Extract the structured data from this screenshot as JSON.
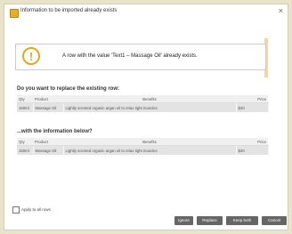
{
  "dialog": {
    "title": "Information to be imported already exists",
    "close_glyph": "×",
    "message": "A row with the value 'Text1 – Massage Oil' already exists."
  },
  "existing": {
    "heading": "Do you want to replace the existing row:",
    "columns": [
      "Qty",
      "Product",
      "Benefits",
      "Price"
    ],
    "row": [
      "150ml",
      "Massage Oil",
      "Lightly scented organic argan oil to relax tight muscles",
      "$20"
    ]
  },
  "incoming": {
    "heading": "...with the information below?",
    "columns": [
      "Qty",
      "Product",
      "Benefits",
      "Price"
    ],
    "row": [
      "150ml",
      "Massage Oil",
      "Lightly scented organic argan oil to relax tight muscles",
      "$20"
    ]
  },
  "apply_all_label": "Apply to all rows",
  "buttons": {
    "ignore": "Ignore",
    "replace": "Replace",
    "keep_both": "Keep both",
    "cancel": "Cancel"
  },
  "colors": {
    "warning_accent": "#e6a81c",
    "button_bg": "#666666",
    "background": "#e9e4c9"
  },
  "icons": {
    "title": "app-icon",
    "warning": "exclamation-circle-icon"
  }
}
